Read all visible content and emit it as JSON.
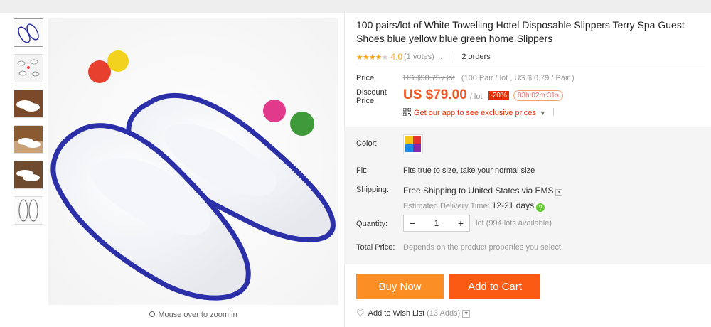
{
  "product": {
    "title": "100 pairs/lot of White Towelling Hotel Disposable Slippers Terry Spa Guest Shoes blue yellow blue green home Slippers",
    "rating": {
      "stars": 4,
      "score": "4.0",
      "votes": "(1 votes)",
      "orders": "2 orders"
    }
  },
  "price": {
    "label": "Price:",
    "original": "US $98.75 / lot",
    "per_unit": "(100 Pair / lot , US $ 0.79 / Pair )",
    "discount_label": "Discount Price:",
    "discount_value": "US $79.00",
    "discount_unit": "/ lot",
    "discount_pct": "-20%",
    "timer": "03h:02m:31s",
    "app_link": "Get our app to see exclusive prices"
  },
  "options": {
    "color_label": "Color:",
    "fit_label": "Fit:",
    "fit_value": "Fits true to size, take your normal size",
    "shipping_label": "Shipping:",
    "shipping_free": "Free Shipping to",
    "shipping_dest": "United States via EMS",
    "delivery_label": "Estimated Delivery Time:",
    "delivery_value": "12-21 days",
    "quantity_label": "Quantity:",
    "quantity_value": "1",
    "quantity_note": "lot (994 lots available)",
    "total_label": "Total Price:",
    "total_value": "Depends on the product properties you select"
  },
  "actions": {
    "buy_now": "Buy Now",
    "add_to_cart": "Add to Cart",
    "wishlist": "Add to Wish List",
    "wishlist_count": "(13 Adds)"
  },
  "gallery": {
    "zoom_hint": "Mouse over to zoom in"
  },
  "colors": {
    "accent": "#f05623",
    "buy_now_bg": "#fb8f26",
    "add_cart_bg": "#fb5a13",
    "star": "#f5a623",
    "slipper_trim": "#2b2fa8"
  }
}
